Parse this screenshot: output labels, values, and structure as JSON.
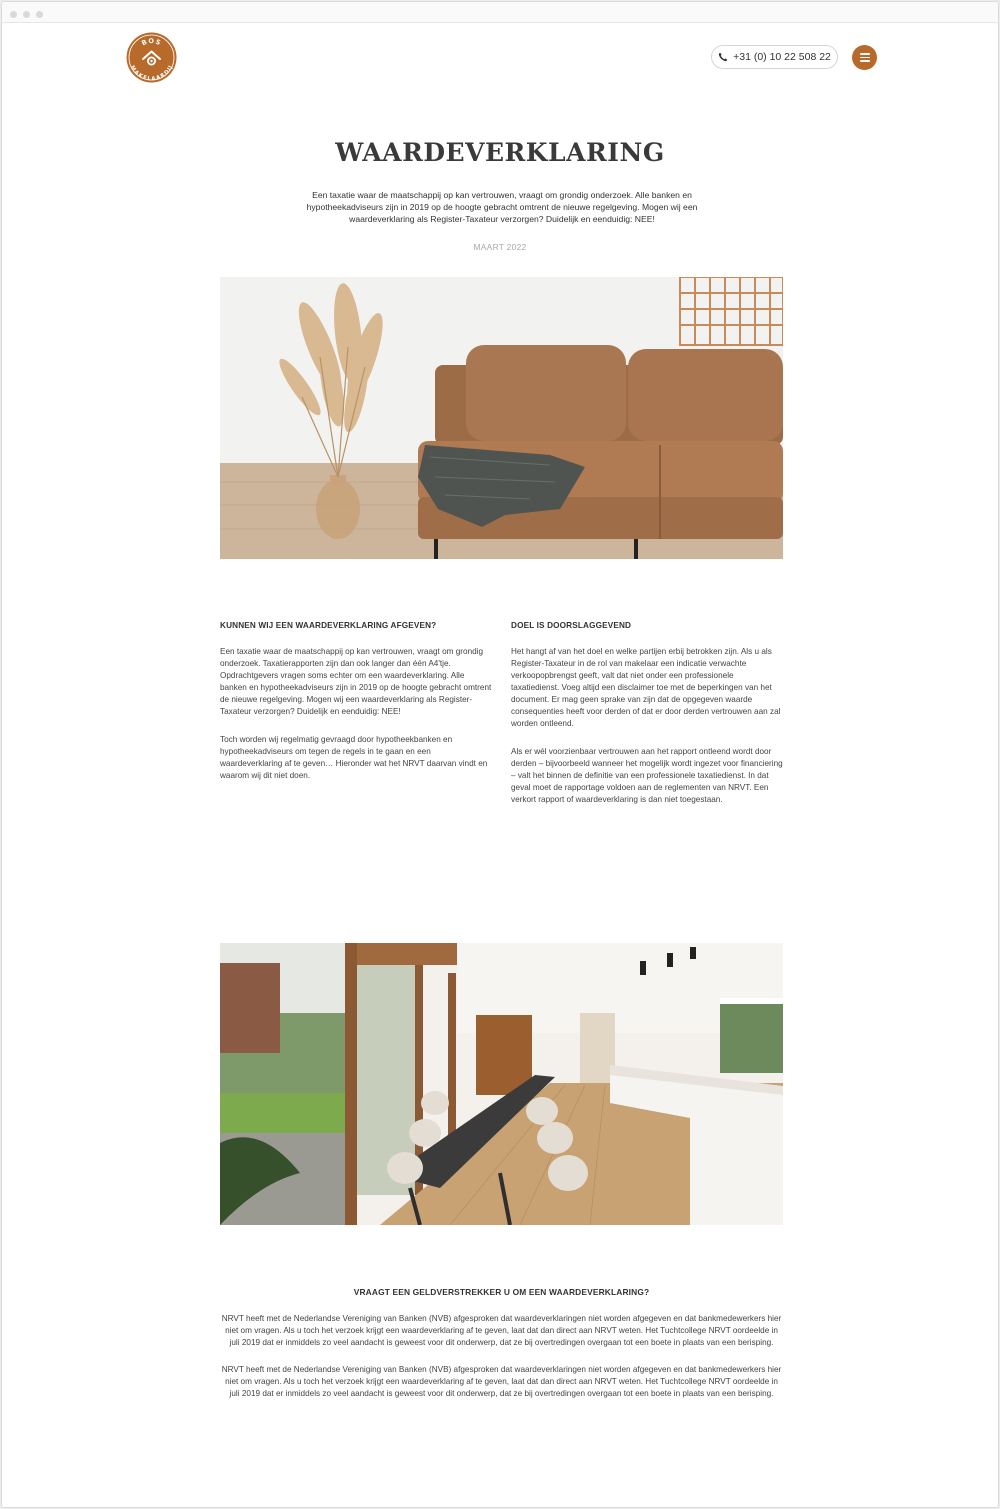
{
  "header": {
    "logo_text_top": "BOS",
    "logo_text_bottom": "MAKELAARDIJ",
    "phone": "+31 (0) 10 22 508 22",
    "menu_icon": "hamburger-icon",
    "phone_icon": "phone-icon",
    "accent_color": "#b86a2b"
  },
  "article": {
    "title": "WAARDEVERKLARING",
    "intro": "Een taxatie waar de maatschappij op kan vertrouwen, vraagt om grondig onderzoek. Alle banken en hypotheekadviseurs zijn in 2019 op de hoogte gebracht omtrent de nieuwe regelgeving. Mogen wij een waardeverklaring als Register-Taxateur verzorgen? Duidelijk en eenduidig: NEE!",
    "date": "MAART 2022"
  },
  "left_column": {
    "heading": "KUNNEN WIJ EEN WAARDEVERKLARING AFGEVEN?",
    "p1": "Een taxatie waar de maatschappij op kan vertrouwen, vraagt om grondig onderzoek. Taxatierapporten zijn dan ook langer dan één A4'tje. Opdrachtgevers vragen soms echter om een waardeverklaring. Alle banken en hypotheekadviseurs zijn in 2019 op de hoogte gebracht omtrent de nieuwe regelgeving. Mogen wij een waardeverklaring als Register-Taxateur verzorgen? Duidelijk en eenduidig: NEE!",
    "p2": "Toch worden wij regelmatig gevraagd door hypotheekbanken en hypotheekadviseurs om tegen de regels in te gaan en een waardeverklaring af te geven… Hieronder wat het NRVT daarvan vindt en waarom wij dit niet doen."
  },
  "right_column": {
    "heading": "DOEL IS DOORSLAGGEVEND",
    "p1": "Het hangt af van het doel en welke partijen erbij betrokken zijn. Als u als Register-Taxateur in de rol van makelaar een indicatie verwachte verkoopopbrengst geeft, valt dat niet onder een professionele taxatiedienst. Voeg altijd een disclaimer toe met de beperkingen van het document. Er mag geen sprake van zijn dat de opgegeven waarde consequenties heeft voor derden of dat er door derden vertrouwen aan zal worden ontleend.",
    "p2": "Als er wél voorzienbaar vertrouwen aan het rapport ontleend wordt door derden – bijvoorbeeld wanneer het mogelijk wordt ingezet voor financiering – valt het binnen de definitie van een professionele taxatiedienst. In dat geval moet de rapportage voldoen aan de reglementen van NRVT. Een verkort rapport of waardeverklaring is dan niet toegestaan."
  },
  "bottom": {
    "heading": "VRAAGT EEN GELDVERSTREKKER U OM EEN WAARDEVERKLARING?",
    "p1": "NRVT heeft met de Nederlandse Vereniging van Banken (NVB) afgesproken dat waardeverklaringen niet worden afgegeven en dat bankmedewerkers hier niet om vragen. Als u toch het verzoek krijgt een waardeverklaring af te geven, laat dat dan direct aan NRVT weten. Het Tuchtcollege NRVT oordeelde in juli 2019 dat er inmiddels zo veel aandacht is geweest voor dit onderwerp, dat ze bij overtredingen overgaan tot een boete in plaats van een berisping.",
    "p2": "NRVT heeft met de Nederlandse Vereniging van Banken (NVB) afgesproken dat waardeverklaringen niet worden afgegeven en dat bankmedewerkers hier niet om vragen. Als u toch het verzoek krijgt een waardeverklaring af te geven, laat dat dan direct aan NRVT weten. Het Tuchtcollege NRVT oordeelde in juli 2019 dat er inmiddels zo veel aandacht is geweest voor dit onderwerp, dat ze bij overtredingen overgaan tot een boete in plaats van een berisping."
  }
}
